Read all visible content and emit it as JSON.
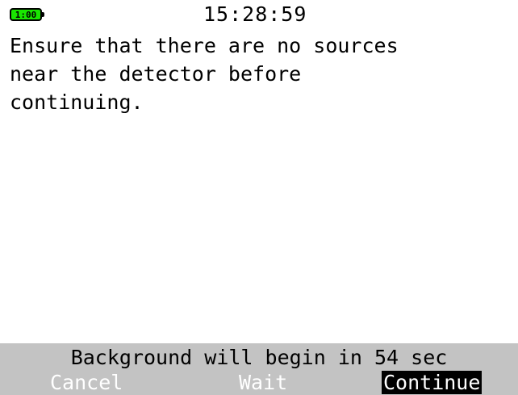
{
  "status": {
    "battery_text": "1:00",
    "battery_color": "#19e600",
    "time": "15:28:59"
  },
  "message": {
    "text": "Ensure that there are no sources\nnear the detector before\ncontinuing."
  },
  "footer": {
    "countdown": "Background will begin in 54 sec",
    "background_color": "#c3c3c3",
    "softkeys": {
      "cancel": "Cancel",
      "wait": "Wait",
      "continue": "Continue"
    }
  }
}
